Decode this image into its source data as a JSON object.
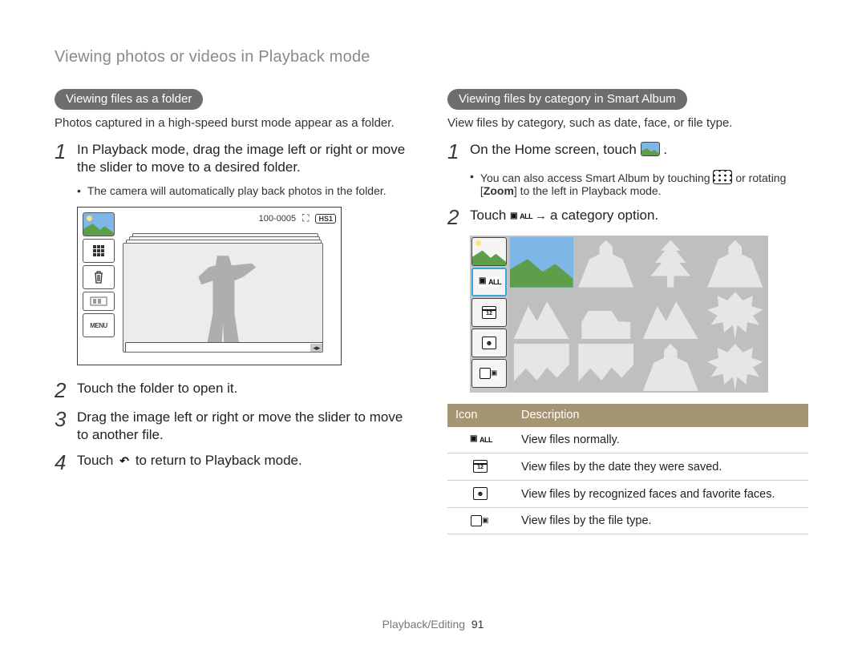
{
  "header": {
    "title": "Viewing photos or videos in Playback mode"
  },
  "left": {
    "section_title": "Viewing files as a folder",
    "intro": "Photos captured in a high-speed burst mode appear as a folder.",
    "step1_num": "1",
    "step1_text": "In Playback mode, drag the image left or right or move the slider to move to a desired folder.",
    "step1_bullet": "The camera will automatically play back photos in the folder.",
    "figure": {
      "top_file_number": "100-0005",
      "badge_hs1": "HS1",
      "menu_label": "MENU"
    },
    "step2_num": "2",
    "step2_text": "Touch the folder to open it.",
    "step3_num": "3",
    "step3_text": "Drag the image left or right or move the slider to move to another file.",
    "step4_num": "4",
    "step4_pre": "Touch ",
    "step4_post": " to return to Playback mode."
  },
  "right": {
    "section_title": "Viewing files by category in Smart Album",
    "intro": "View files by category, such as date, face, or file type.",
    "step1_num": "1",
    "step1_pre": "On the Home screen, touch ",
    "step1_post": " .",
    "step1_bullet_pre": "You can also access Smart Album by touching ",
    "step1_bullet_mid": " or rotating [",
    "step1_bullet_zoom": "Zoom",
    "step1_bullet_post": "] to the left in Playback mode.",
    "step2_num": "2",
    "step2_pre": "Touch ",
    "step2_arrow": " → ",
    "step2_post": "a category option.",
    "sidebar": {
      "all_label": "ALL",
      "date_label": "12"
    },
    "table": {
      "header_icon": "Icon",
      "header_desc": "Description",
      "rows": [
        {
          "desc": "View files normally."
        },
        {
          "desc": "View files by the date they were saved."
        },
        {
          "desc": "View files by recognized faces and favorite faces."
        },
        {
          "desc": "View files by the file type."
        }
      ]
    }
  },
  "footer": {
    "section": "Playback/Editing",
    "page_number": "91"
  }
}
